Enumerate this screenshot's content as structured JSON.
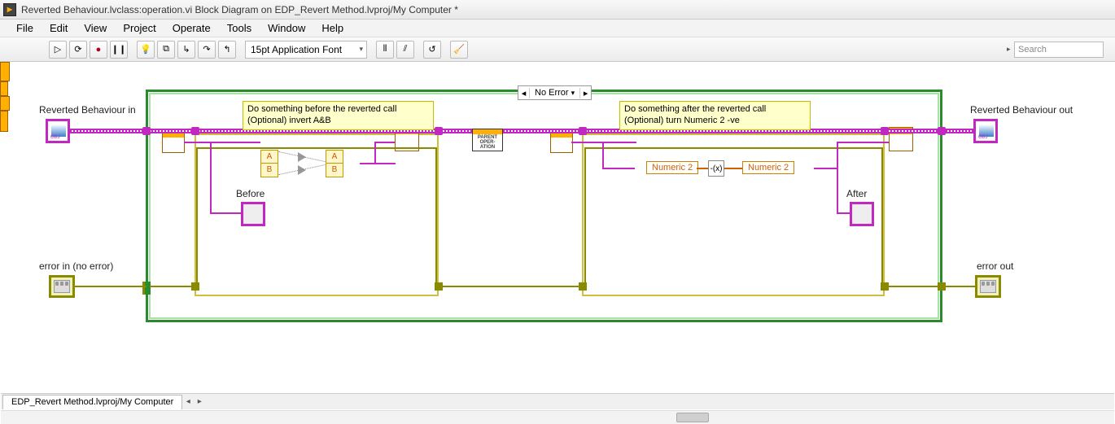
{
  "window": {
    "title": "Reverted Behaviour.lvclass:operation.vi Block Diagram on EDP_Revert Method.lvproj/My Computer *"
  },
  "menu": {
    "file": "File",
    "edit": "Edit",
    "view": "View",
    "project": "Project",
    "operate": "Operate",
    "tools": "Tools",
    "window": "Window",
    "help": "Help"
  },
  "toolbar": {
    "run": "▷",
    "run_cont": "⟳",
    "abort": "●",
    "pause": "❙❙",
    "hilite": "💡",
    "retain": "⧉",
    "step_into": "↳",
    "step_over": "↷",
    "step_out": "↰",
    "font_selector": "15pt Application Font",
    "align": "⫴",
    "distribute": "⫽",
    "reorder": "↺",
    "cleanup": "🧹",
    "search_placeholder": "Search"
  },
  "case": {
    "selector_label": "No Error"
  },
  "comments": {
    "before_line1": "Do something before the reverted call",
    "before_line2": "(Optional) invert A&B",
    "after_line1": "Do something after the reverted call",
    "after_line2": "(Optional) turn Numeric 2 -ve"
  },
  "terminals": {
    "class_in": "Reverted Behaviour in",
    "class_out": "Reverted Behaviour out",
    "error_in": "error in (no error)",
    "error_out": "error out",
    "before": "Before",
    "after": "After"
  },
  "nodes": {
    "parent_top": "PARENT",
    "parent_mid": "OPER-",
    "parent_bot": "ATION",
    "cell_a": "A",
    "cell_b": "B",
    "numeric2_l": "Numeric 2",
    "numeric2_r": "Numeric 2",
    "mult": "-(x)"
  },
  "tab": {
    "label": "EDP_Revert Method.lvproj/My Computer"
  }
}
